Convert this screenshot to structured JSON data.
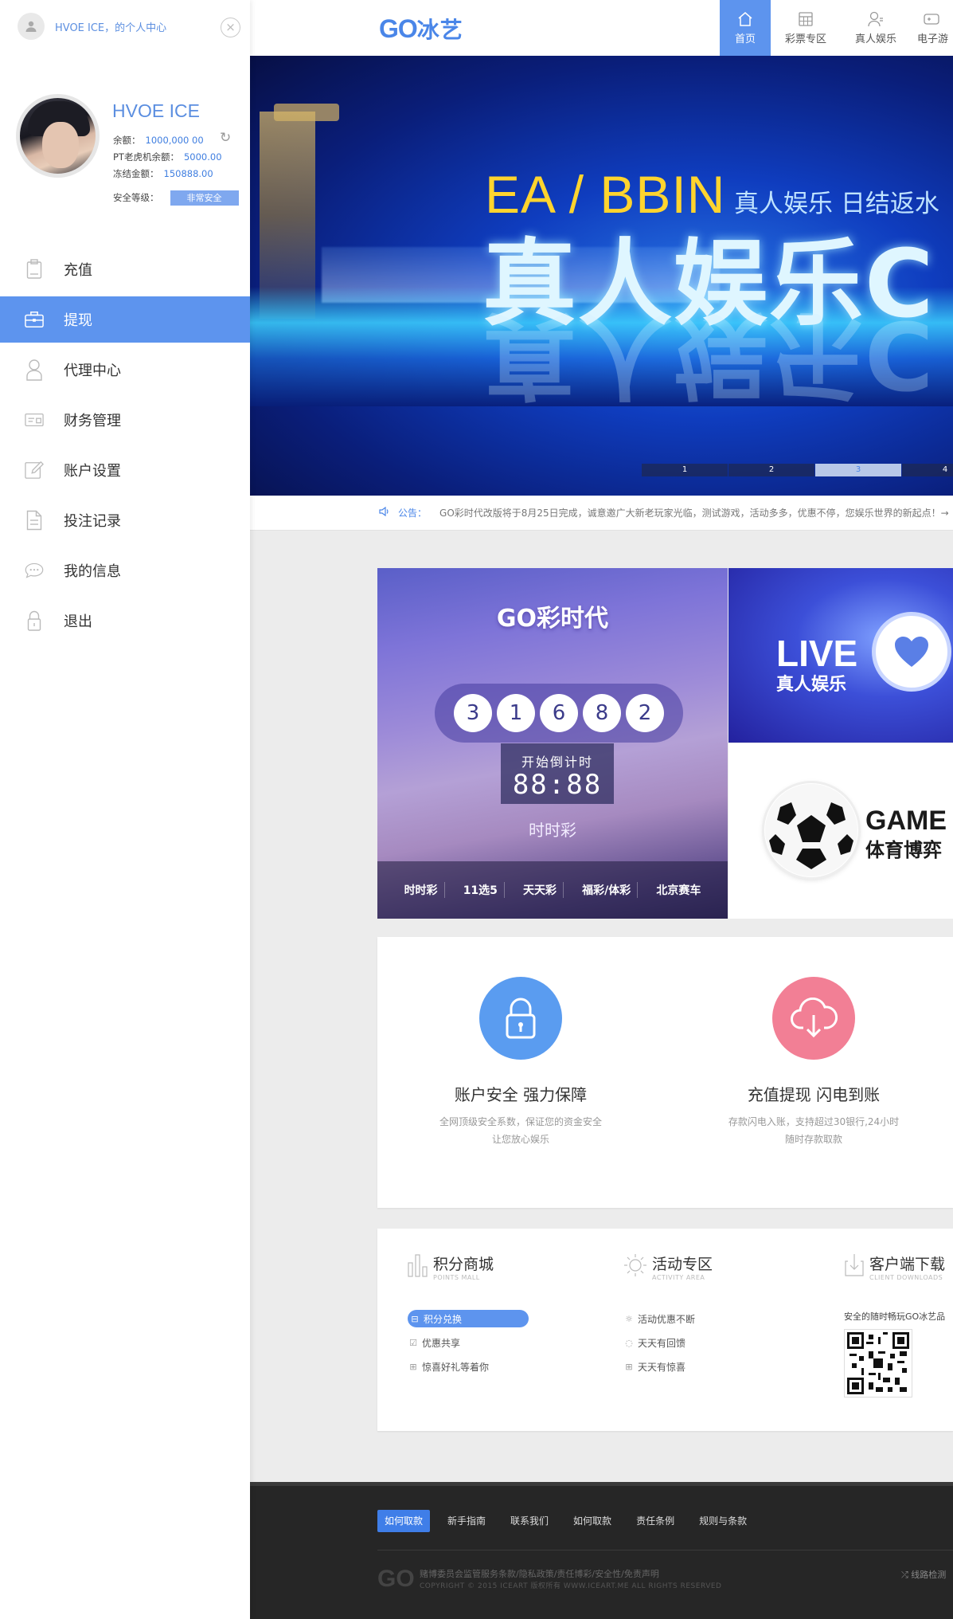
{
  "sidebar": {
    "crumb": "HVOE ICE，的个人中心",
    "close_icon": "×",
    "user": {
      "name": "HVOE ICE",
      "balance_label": "余额：",
      "balance_value": "1000,000 00",
      "pt_label": "PT老虎机余额：",
      "pt_value": "5000.00",
      "frozen_label": "冻结金额：",
      "frozen_value": "150888.00",
      "security_label": "安全等级：",
      "security_value": "非常安全"
    },
    "menu": [
      {
        "label": "充值",
        "icon": "recharge-icon"
      },
      {
        "label": "提现",
        "icon": "withdraw-icon",
        "active": true
      },
      {
        "label": "代理中心",
        "icon": "agent-icon"
      },
      {
        "label": "财务管理",
        "icon": "finance-icon"
      },
      {
        "label": "账户设置",
        "icon": "edit-icon"
      },
      {
        "label": "投注记录",
        "icon": "document-icon"
      },
      {
        "label": "我的信息",
        "icon": "message-icon"
      },
      {
        "label": "退出",
        "icon": "lock-icon"
      }
    ]
  },
  "header": {
    "logo_latin": "GO",
    "logo_cn": "冰艺",
    "nav": [
      {
        "label": "首页",
        "icon": "home-icon",
        "active": true
      },
      {
        "label": "彩票专区",
        "icon": "calculator-icon"
      },
      {
        "label": "真人娱乐",
        "icon": "person-icon"
      },
      {
        "label": "电子游",
        "icon": "gamepad-icon"
      }
    ]
  },
  "banner": {
    "headline": "EA / BBIN",
    "subline": "真人娱乐 日结返水",
    "big_text": "真人娱乐C",
    "pager": [
      "1",
      "2",
      "3",
      "4"
    ],
    "active_page": "3"
  },
  "notice": {
    "label": "公告：",
    "text": "GO彩时代改版将于8月25日完成，诚意邀广大新老玩家光临，测试游戏，活动多多，优惠不停，您娱乐世界的新起点！→"
  },
  "tiles": {
    "lottery": {
      "logo": "GO彩时代",
      "balls": [
        "3",
        "1",
        "6",
        "8",
        "2"
      ],
      "countdown_label": "开始倒计时",
      "countdown_value": "88:88",
      "game_name": "时时彩",
      "sub_games": [
        "时时彩",
        "11选5",
        "天天彩",
        "福彩/体彩",
        "北京赛车"
      ]
    },
    "live": {
      "title": "LIVE",
      "subtitle": "真人娱乐"
    },
    "game": {
      "title": "GAME",
      "subtitle": "体育博弈"
    }
  },
  "features": [
    {
      "title": "账户安全 强力保障",
      "desc1": "全网顶级安全系数，保证您的资金安全",
      "desc2": "让您放心娱乐",
      "color": "#5a9cf0",
      "icon": "lock-icon"
    },
    {
      "title": "充值提现 闪电到账",
      "desc1": "存款闪电入账，支持超过30银行,24小时",
      "desc2": "随时存款取款",
      "color": "#f27f95",
      "icon": "cloud-download-icon"
    }
  ],
  "extra": {
    "points": {
      "title": "积分商城",
      "subtitle": "POINTS MALL",
      "items": [
        "积分兑换",
        "优惠共享",
        "惊喜好礼等着你"
      ]
    },
    "activity": {
      "title": "活动专区",
      "subtitle": "ACTIVITY AREA",
      "items": [
        "活动优惠不断",
        "天天有回馈",
        "天天有惊喜"
      ]
    },
    "client": {
      "title": "客户端下载",
      "subtitle": "CLIENT DOWNLOADS",
      "qr_text": "安全的随时畅玩GO冰艺品"
    }
  },
  "footer": {
    "links": [
      "如何取款",
      "新手指南",
      "联系我们",
      "如何取款",
      "责任条例",
      "规则与条款"
    ],
    "logo": "GO",
    "text": "赌博委员会监管服务条款/隐私政策/责任博彩/安全性/免责声明",
    "copyright": "COPYRIGHT © 2015  ICEART 版权所有 WWW.ICEART.ME  ALL RIGHTS RESERVED",
    "route": "线路检测"
  }
}
